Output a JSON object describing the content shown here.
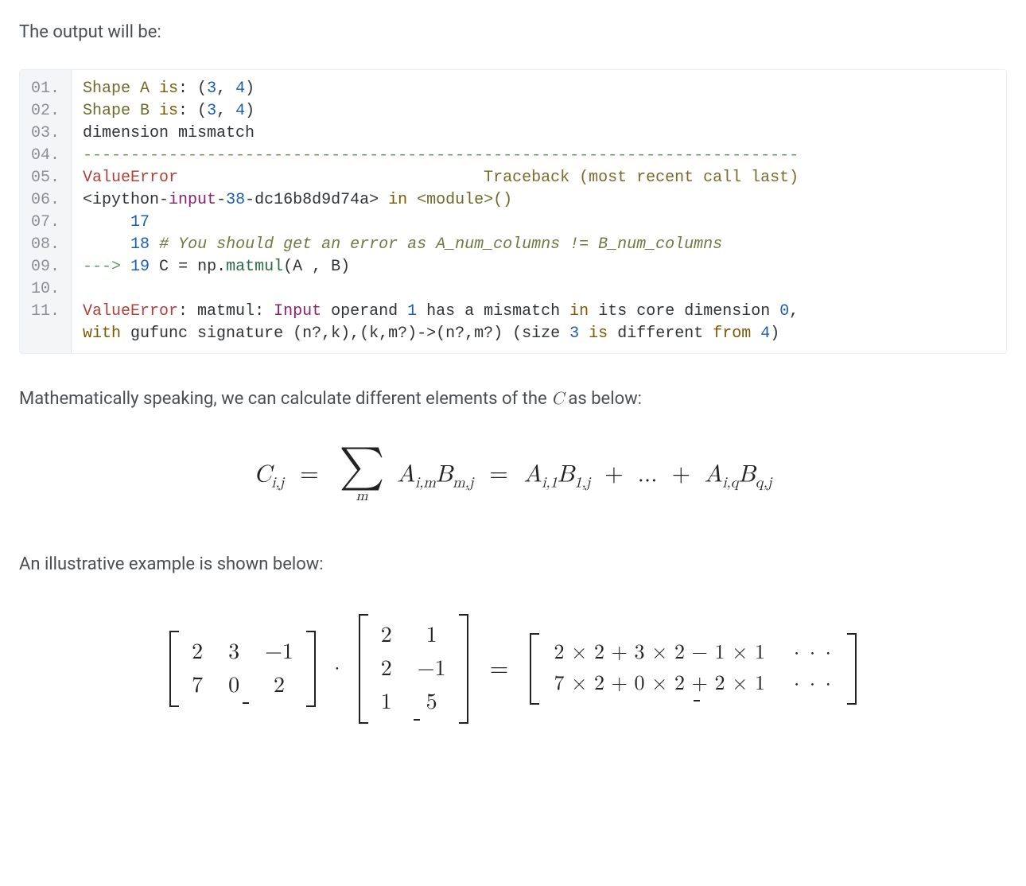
{
  "intro_text": "The output will be:",
  "code": {
    "line_numbers": [
      "01.",
      "02.",
      "03.",
      "04.",
      "05.",
      "06.",
      "07.",
      "08.",
      "09.",
      "10.",
      "11."
    ],
    "l1": {
      "a": "Shape A ",
      "kw": "is",
      "b": ": (",
      "n1": "3",
      "c": ", ",
      "n2": "4",
      "d": ")"
    },
    "l2": {
      "a": "Shape B ",
      "kw": "is",
      "b": ": (",
      "n1": "3",
      "c": ", ",
      "n2": "4",
      "d": ")"
    },
    "l3": "dimension mismatch",
    "l4": "---------------------------------------------------------------------------",
    "l5": {
      "err": "ValueError",
      "sp": "                                ",
      "trace": "Traceback (most recent call last)"
    },
    "l6": {
      "a": "<ipython-",
      "b": "input",
      "c": "-",
      "d": "38",
      "e": "-dc16b8d9d74a> ",
      "f": "in",
      "g": " <module>()"
    },
    "l7": {
      "pad": "     ",
      "n": "17"
    },
    "l8": {
      "pad": "     ",
      "n": "18",
      "sp": " ",
      "cmt": "# You should get an error as A_num_columns != B_num_columns"
    },
    "l9": {
      "arrow": "---> ",
      "n": "19",
      "sp": " C ",
      "eq": "=",
      "sp2": " np",
      "dot": ".",
      "fn": "matmul",
      "args": "(A , B)"
    },
    "l11a": {
      "err": "ValueError",
      "a": ": matmul: ",
      "b": "Input",
      "c": " operand ",
      "n1": "1",
      "d": " has a mismatch ",
      "kw": "in",
      "e": " its core dimension ",
      "n0": "0",
      "f": ","
    },
    "l11b": {
      "a": "with",
      "b": " gufunc signature (n?,k),(k,m?)",
      "c": "->",
      "d": "(n?,m?) (size ",
      "n3": "3",
      "e": " ",
      "kw": "is",
      "f": " different ",
      "g": "from",
      "h": " ",
      "n4": "4",
      "i": ")"
    }
  },
  "para2_a": "Mathematically speaking, we can calculate different elements of the ",
  "para2_var": "C",
  "para2_b": " as below:",
  "formula": {
    "lhs_base": "C",
    "lhs_sub": "i,j",
    "sum_below": "m",
    "t1_base": "A",
    "t1_sub": "i,m",
    "t2_base": "B",
    "t2_sub": "m,j",
    "t3_base": "A",
    "t3_sub": "i,1",
    "t4_base": "B",
    "t4_sub": "1,j",
    "dots": "...",
    "t5_base": "A",
    "t5_sub": "i,q",
    "t6_base": "B",
    "t6_sub": "q,j"
  },
  "para3": "An illustrative example is shown below:",
  "matrices": {
    "A": [
      [
        "2",
        "3",
        "−1"
      ],
      [
        "7",
        "0",
        "2"
      ]
    ],
    "B": [
      [
        "2",
        "1"
      ],
      [
        "2",
        "−1"
      ],
      [
        "1",
        "5"
      ]
    ],
    "R": [
      [
        "2 × 2 + 3 × 2 − 1 × 1",
        "· · ·"
      ],
      [
        "7 × 2 + 0 × 2 + 2 × 1",
        "· · ·"
      ]
    ]
  }
}
